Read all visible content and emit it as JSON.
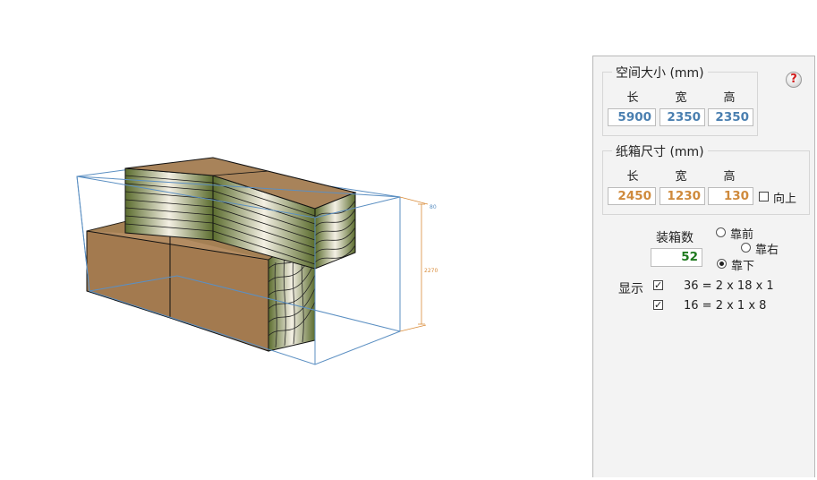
{
  "space": {
    "title": "空间大小 (mm)",
    "headers": [
      "长",
      "宽",
      "高"
    ],
    "values": [
      "5900",
      "2350",
      "2350"
    ]
  },
  "carton": {
    "title": "纸箱尺寸 (mm)",
    "headers": [
      "长",
      "宽",
      "高"
    ],
    "values": [
      "2450",
      "1230",
      "130"
    ],
    "upright_label": "向上",
    "upright_checked": false
  },
  "count": {
    "label": "装箱数",
    "value": "52"
  },
  "align": {
    "options": [
      "靠前",
      "靠右",
      "靠下"
    ],
    "selected": "靠下"
  },
  "display": {
    "label": "显示",
    "rows": [
      {
        "checked": true,
        "text": "36 = 2 x 18 x 1"
      },
      {
        "checked": true,
        "text": "16 = 2 x 1 x 8"
      }
    ]
  },
  "dimension": {
    "top_label": "80",
    "side_label": "2270"
  },
  "help_icon": "?",
  "colors": {
    "box_edge": "#5b8fc2",
    "carton": "#a8835a",
    "dim_line": "#d98c3a"
  }
}
